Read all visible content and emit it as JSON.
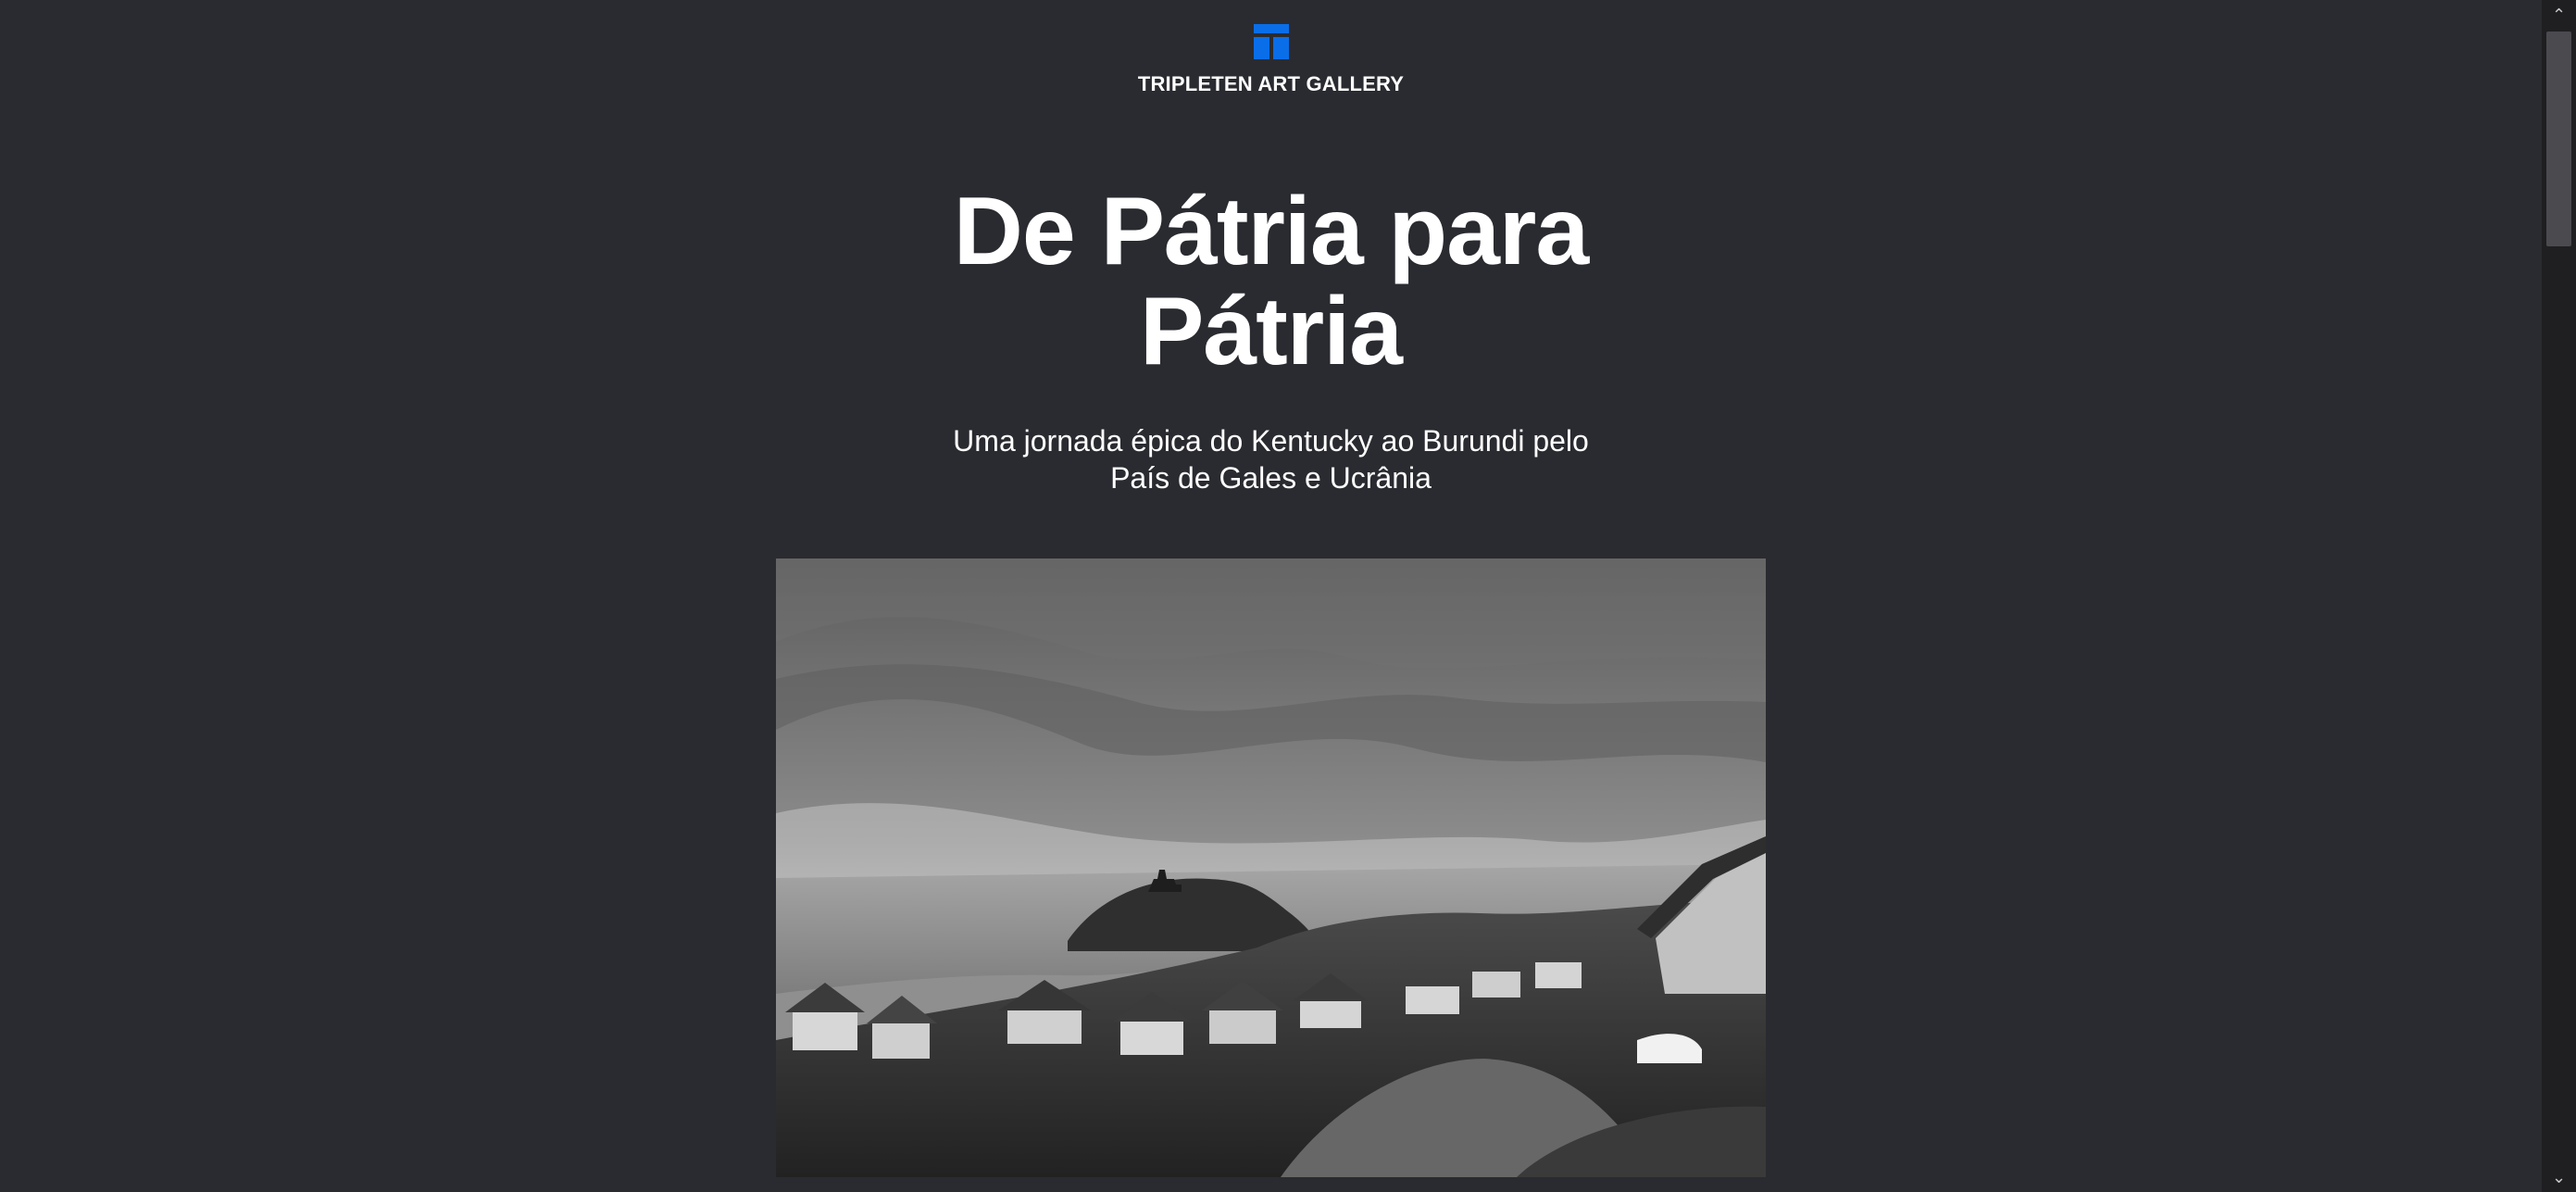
{
  "header": {
    "brand_name": "TRIPLETEN ART GALLERY",
    "logo_icon": "window-layout-icon",
    "logo_color": "#0a6ee8"
  },
  "hero": {
    "title_line1": "De Pátria para",
    "title_line2": "Pátria",
    "subtitle_line1": "Uma jornada épica do Kentucky ao Burundi pelo",
    "subtitle_line2": "País de Gales e Ucrânia"
  },
  "image": {
    "description": "Black-and-white coastal town photo"
  },
  "colors": {
    "background": "#2a2b30",
    "text": "#ffffff",
    "accent": "#0a6ee8"
  }
}
